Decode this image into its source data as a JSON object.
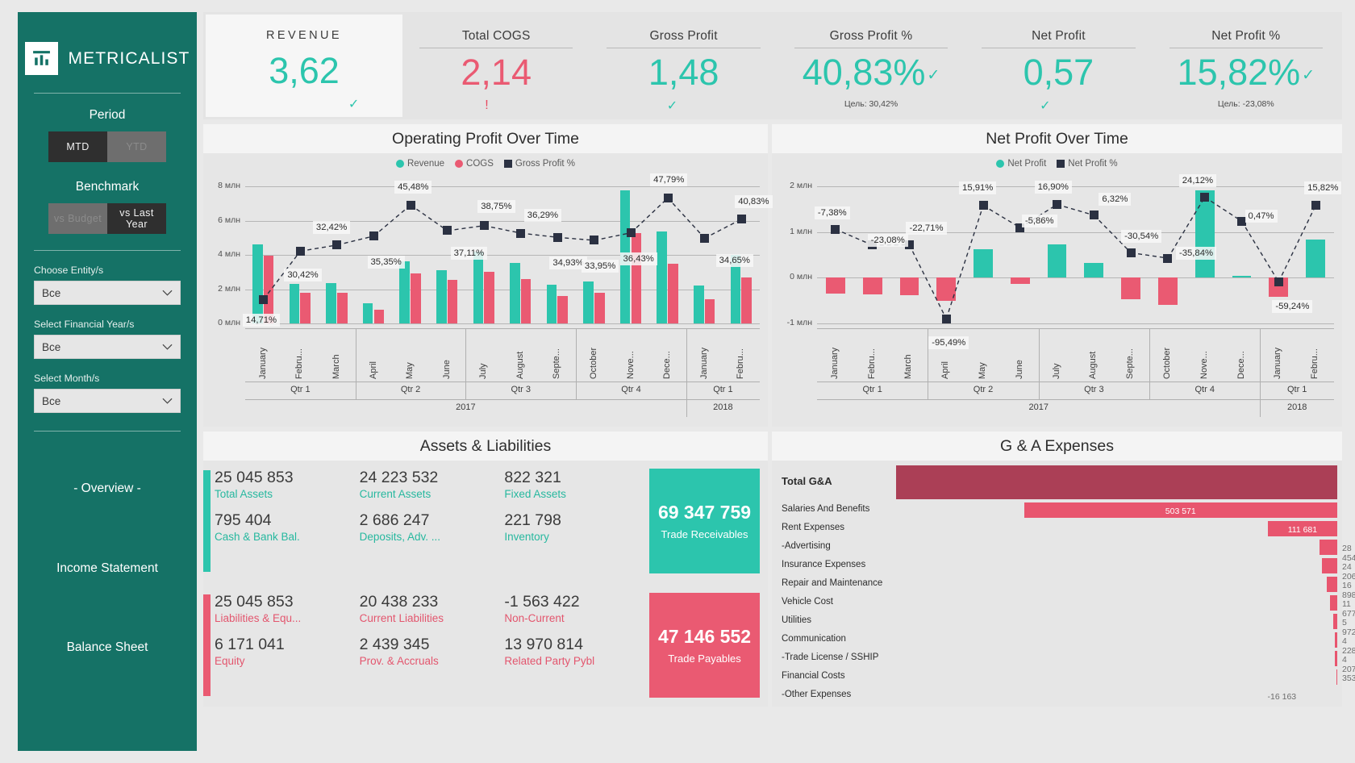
{
  "sidebar": {
    "brand": "METRICALIST",
    "period_title": "Period",
    "period_options": [
      {
        "label": "MTD",
        "active": true
      },
      {
        "label": "YTD",
        "active": false
      }
    ],
    "benchmark_title": "Benchmark",
    "benchmark_options": [
      {
        "label": "vs Budget",
        "active": false
      },
      {
        "label": "vs Last Year",
        "active": true
      }
    ],
    "filters": [
      {
        "label": "Choose Entity/s",
        "value": "Все"
      },
      {
        "label": "Select Financial Year/s",
        "value": "Все"
      },
      {
        "label": "Select Month/s",
        "value": "Все"
      }
    ],
    "nav": [
      {
        "label": "- Overview -"
      },
      {
        "label": "Income Statement"
      },
      {
        "label": "Balance Sheet"
      }
    ]
  },
  "kpis": [
    {
      "title": "REVENUE",
      "value": "3,62",
      "tone": "positive",
      "status": "ok",
      "goal": ""
    },
    {
      "title": "Total COGS",
      "value": "2,14",
      "tone": "negative",
      "status": "warn",
      "goal": ""
    },
    {
      "title": "Gross Profit",
      "value": "1,48",
      "tone": "positive",
      "status": "ok",
      "goal": ""
    },
    {
      "title": "Gross Profit %",
      "value": "40,83%",
      "tone": "positive",
      "status": "inline-ok",
      "goal": "Цель: 30,42%"
    },
    {
      "title": "Net Profit",
      "value": "0,57",
      "tone": "positive",
      "status": "ok",
      "goal": ""
    },
    {
      "title": "Net Profit %",
      "value": "15,82%",
      "tone": "positive",
      "status": "inline-ok",
      "goal": "Цель: -23,08%"
    }
  ],
  "panels": {
    "operating": {
      "title": "Operating Profit Over Time"
    },
    "netprofit": {
      "title": "Net Profit Over Time"
    },
    "assets": {
      "title": "Assets & Liabilities"
    },
    "ga": {
      "title": "G & A Expenses"
    }
  },
  "colors": {
    "teal": "#2cc5ad",
    "pink": "#ea5a72",
    "dark": "#2b3142",
    "brand_green": "#157266",
    "ga_total": "#ab3f56",
    "ga_bar": "#e8556e"
  },
  "chart_data": [
    {
      "type": "bar",
      "title": "Operating Profit Over Time",
      "xlabel": "",
      "ylabel": "",
      "ylim": [
        0,
        8
      ],
      "ytick_labels": [
        "0 млн",
        "2 млн",
        "4 млн",
        "6 млн",
        "8 млн"
      ],
      "grid": true,
      "legend_position": "top",
      "legend": [
        "Revenue",
        "COGS",
        "Gross Profit %"
      ],
      "categories": [
        "January",
        "Febru...",
        "March",
        "April",
        "May",
        "June",
        "July",
        "August",
        "Septe...",
        "October",
        "Nove...",
        "Dece...",
        "January",
        "Febru..."
      ],
      "quarters": [
        "Qtr 1",
        "Qtr 2",
        "Qtr 3",
        "Qtr 4",
        "Qtr 1"
      ],
      "quarter_spans": [
        3,
        3,
        3,
        3,
        2
      ],
      "years": [
        "2017",
        "2018"
      ],
      "year_spans": [
        12,
        2
      ],
      "series": [
        {
          "name": "Revenue",
          "type": "bar",
          "color": "#2cc5ad",
          "values": [
            4.62,
            2.3,
            2.36,
            1.18,
            3.64,
            3.1,
            4.18,
            3.52,
            2.28,
            2.44,
            7.75,
            5.36,
            2.22,
            4.02
          ]
        },
        {
          "name": "COGS",
          "type": "bar",
          "color": "#ea5a72",
          "values": [
            3.94,
            1.78,
            1.78,
            0.8,
            2.92,
            2.56,
            3.0,
            2.6,
            1.62,
            1.8,
            5.28,
            3.5,
            1.42,
            2.68
          ]
        },
        {
          "name": "Gross Profit %",
          "type": "line",
          "color": "#2b3142",
          "values": [
            14.71,
            30.42,
            32.42,
            35.35,
            45.48,
            37.11,
            38.75,
            36.29,
            34.93,
            33.95,
            36.43,
            47.79,
            34.65,
            40.83
          ],
          "labels": [
            "14,71%",
            "30,42%",
            "32,42%",
            "35,35%",
            "45,48%",
            "37,11%",
            "38,75%",
            "36,29%",
            "34,93%",
            "33,95%",
            "36,43%",
            "47,79%",
            "34,65%",
            "40,83%"
          ]
        }
      ]
    },
    {
      "type": "bar",
      "title": "Net Profit Over Time",
      "xlabel": "",
      "ylabel": "",
      "ylim": [
        -1,
        2
      ],
      "ytick_labels": [
        "-1 млн",
        "0 млн",
        "1 млн",
        "2 млн"
      ],
      "grid": true,
      "legend_position": "top",
      "legend": [
        "Net Profit",
        "Net Profit %"
      ],
      "categories": [
        "January",
        "Febru...",
        "March",
        "April",
        "May",
        "June",
        "July",
        "August",
        "Septe...",
        "October",
        "Nove...",
        "Dece...",
        "January",
        "Febru..."
      ],
      "quarters": [
        "Qtr 1",
        "Qtr 2",
        "Qtr 3",
        "Qtr 4",
        "Qtr 1"
      ],
      "quarter_spans": [
        3,
        3,
        3,
        3,
        2
      ],
      "years": [
        "2017",
        "2018"
      ],
      "year_spans": [
        12,
        2
      ],
      "series": [
        {
          "name": "Net Profit",
          "type": "bar",
          "color_positive": "#2cc5ad",
          "color_negative": "#ea5a72",
          "values": [
            -0.34,
            -0.36,
            -0.38,
            -0.5,
            0.62,
            -0.13,
            0.73,
            0.33,
            -0.47,
            -0.6,
            1.92,
            0.05,
            -0.42,
            0.84
          ]
        },
        {
          "name": "Net Profit %",
          "type": "line",
          "color": "#2b3142",
          "values": [
            -7.38,
            -23.08,
            -22.71,
            -95.49,
            15.91,
            -5.86,
            16.9,
            6.32,
            -30.54,
            -35.84,
            24.12,
            0.47,
            -59.24,
            15.82
          ],
          "labels": [
            "-7,38%",
            "-23,08%",
            "-22,71%",
            "-95,49%",
            "15,91%",
            "-5,86%",
            "16,90%",
            "6,32%",
            "-30,54%",
            "-35,84%",
            "24,12%",
            "0,47%",
            "-59,24%",
            "15,82%"
          ]
        }
      ]
    },
    {
      "type": "bar",
      "title": "G & A Expenses",
      "orientation": "horizontal",
      "xlabel": "",
      "ylabel": "",
      "grid": false,
      "categories": [
        "Total G&A",
        "Salaries And Benefits",
        "Rent Expenses",
        "-Advertising",
        "Insurance Expenses",
        "Repair and Maintenance",
        "Vehicle Cost",
        "Utilities",
        "Communication",
        "-Trade License / SSHIP",
        "Financial Costs",
        "-Other Expenses"
      ],
      "values": [
        709124,
        503571,
        111681,
        28454,
        24206,
        16898,
        11677,
        5972,
        4228,
        4207,
        353,
        -16163
      ],
      "value_labels": [
        "",
        "503 571",
        "111 681",
        "28 454",
        "24 206",
        "16 898",
        "11 677",
        "5 972",
        "4 228",
        "4 207",
        "353",
        "-16 163"
      ]
    }
  ],
  "assets": {
    "rows": [
      {
        "accent": "teal",
        "cells": [
          {
            "num": "25 045 853",
            "label": "Total Assets",
            "num2": "795 404",
            "label2": "Cash & Bank Bal."
          },
          {
            "num": "24 223 532",
            "label": "Current Assets",
            "num2": "2 686 247",
            "label2": "Deposits, Adv. ..."
          },
          {
            "num": "822 321",
            "label": "Fixed Assets",
            "num2": "221 798",
            "label2": "Inventory"
          }
        ],
        "big": {
          "value": "69 347 759",
          "label": "Trade Receivables"
        }
      },
      {
        "accent": "pink",
        "cells": [
          {
            "num": "25 045 853",
            "label": "Liabilities & Equ...",
            "num2": "6 171 041",
            "label2": "Equity"
          },
          {
            "num": "20 438 233",
            "label": "Current Liabilities",
            "num2": "2 439 345",
            "label2": "Prov. & Accruals"
          },
          {
            "num": "-1 563 422",
            "label": "Non-Current",
            "num2": "13 970 814",
            "label2": "Related Party Pybl"
          }
        ],
        "big": {
          "value": "47 146 552",
          "label": "Trade Payables"
        }
      }
    ]
  }
}
